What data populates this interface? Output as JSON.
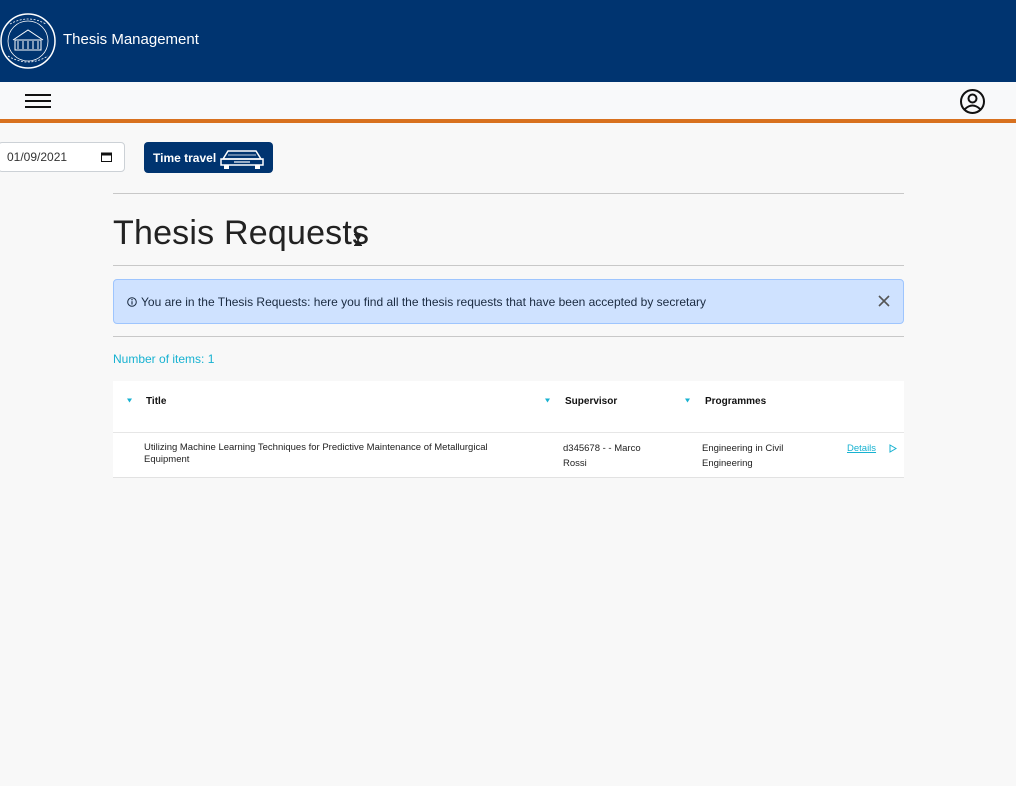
{
  "header": {
    "app_title": "Thesis Management",
    "brand_color": "#003470",
    "accent_color": "#d8711f"
  },
  "navbar": {
    "menu_icon": "hamburger-menu-icon",
    "user_icon": "user-circle-icon"
  },
  "time_travel": {
    "date_value": "01/09/2021",
    "button_label": "Time travel",
    "button_icon": "car-icon"
  },
  "main": {
    "page_title": "Thesis Requests",
    "title_icon": "hourglass-icon",
    "alert": {
      "icon": "info-icon",
      "text": "You are in the Thesis Requests: here you find all the thesis requests that have been accepted by secretary",
      "close_icon": "close-icon"
    },
    "items_count_label": "Number of items: 1",
    "table": {
      "columns": [
        "Title",
        "Supervisor",
        "Programmes"
      ],
      "rows": [
        {
          "title": "Utilizing Machine Learning Techniques for Predictive Maintenance of Metallurgical Equipment",
          "supervisor": "d345678 - - Marco Rossi",
          "programmes": "Engineering in Civil Engineering",
          "action_label": "Details",
          "action_icon": "play-arrow-icon"
        }
      ]
    }
  }
}
